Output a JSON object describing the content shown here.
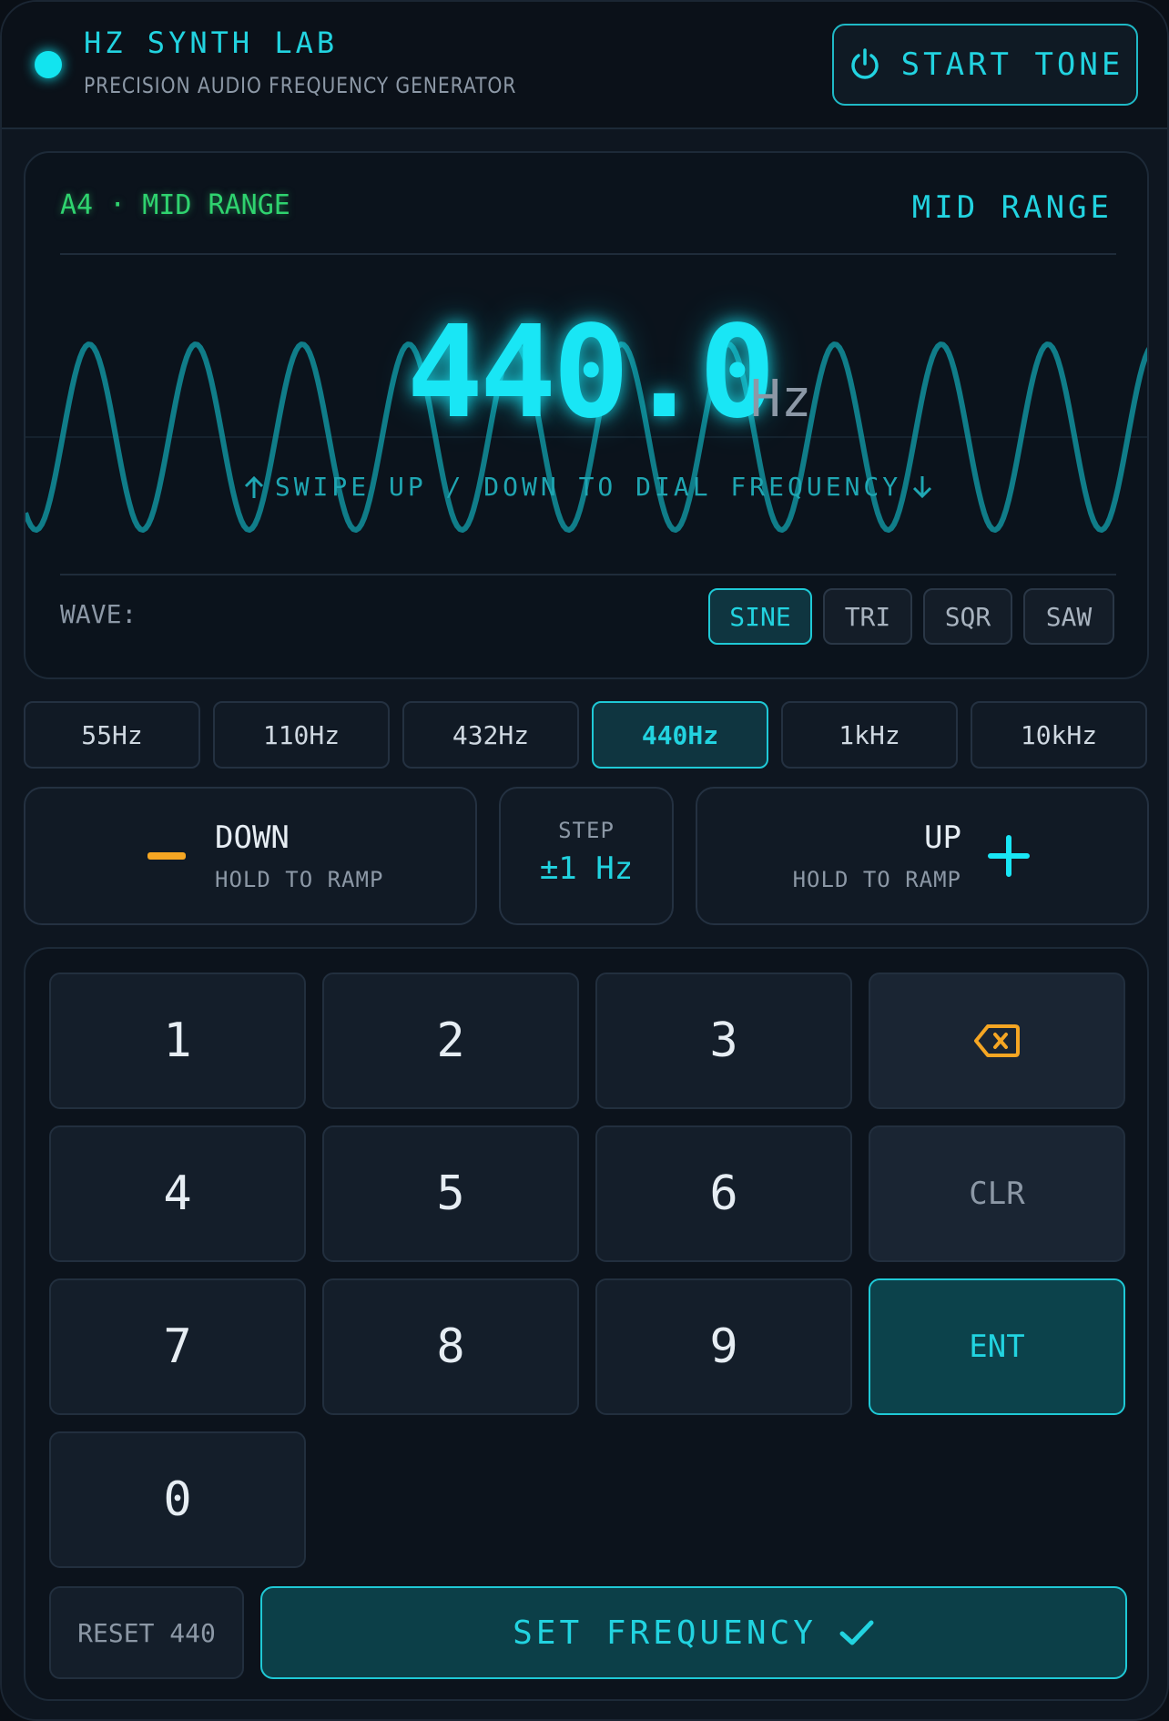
{
  "header": {
    "title": "HZ SYNTH LAB",
    "subtitle": "PRECISION AUDIO FREQUENCY GENERATOR",
    "start_label": "START TONE"
  },
  "display": {
    "note_label": "A4 · MID RANGE",
    "range_label": "MID RANGE",
    "frequency": "440.0",
    "unit": "Hz",
    "swipe_hint": "SWIPE UP / DOWN TO DIAL FREQUENCY",
    "wave_label": "WAVE:",
    "wave_options": [
      "SINE",
      "TRI",
      "SQR",
      "SAW"
    ],
    "selected_wave": "SINE"
  },
  "presets": {
    "items": [
      "55Hz",
      "110Hz",
      "432Hz",
      "440Hz",
      "1kHz",
      "10kHz"
    ],
    "selected": "440Hz"
  },
  "controls": {
    "down_title": "DOWN",
    "down_sub": "HOLD TO RAMP",
    "step_title": "STEP",
    "step_value": "±1 Hz",
    "up_title": "UP",
    "up_sub": "HOLD TO RAMP"
  },
  "keypad": {
    "keys": [
      "1",
      "2",
      "3",
      "4",
      "5",
      "6",
      "7",
      "8",
      "9",
      "0"
    ],
    "clear_label": "CLR",
    "enter_label": "ENT",
    "reset_label": "RESET 440",
    "set_label": "SET FREQUENCY"
  },
  "colors": {
    "accent": "#22d3e0",
    "note_green": "#2fd36f",
    "warning_orange": "#f5a623",
    "background": "#0e1620"
  },
  "icons": {
    "power": "power-icon",
    "backspace": "backspace-icon",
    "minus": "minus-icon",
    "plus": "plus-icon",
    "check": "check-icon",
    "arrow_up": "arrow-up-icon",
    "arrow_down": "arrow-down-icon"
  }
}
